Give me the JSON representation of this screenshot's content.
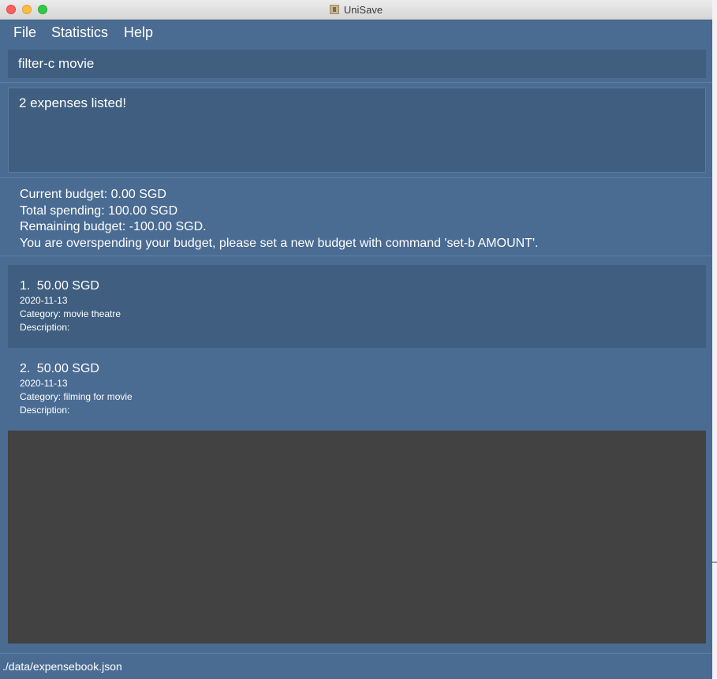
{
  "window": {
    "title": "UniSave"
  },
  "menu": {
    "file": "File",
    "statistics": "Statistics",
    "help": "Help"
  },
  "command": {
    "value": "filter-c movie"
  },
  "result": {
    "message": "2 expenses listed!"
  },
  "budget": {
    "current": "Current budget: 0.00 SGD",
    "total": "Total spending: 100.00 SGD",
    "remaining": "Remaining budget: -100.00 SGD.",
    "warning": "You are overspending your budget, please set a new budget with command 'set-b AMOUNT'."
  },
  "expenses": [
    {
      "index": "1.",
      "amount": "50.00 SGD",
      "date": "2020-11-13",
      "category": "Category: movie theatre",
      "description": "Description:"
    },
    {
      "index": "2.",
      "amount": "50.00 SGD",
      "date": "2020-11-13",
      "category": "Category: filming for movie",
      "description": "Description:"
    }
  ],
  "status": {
    "path": "./data/expensebook.json"
  }
}
